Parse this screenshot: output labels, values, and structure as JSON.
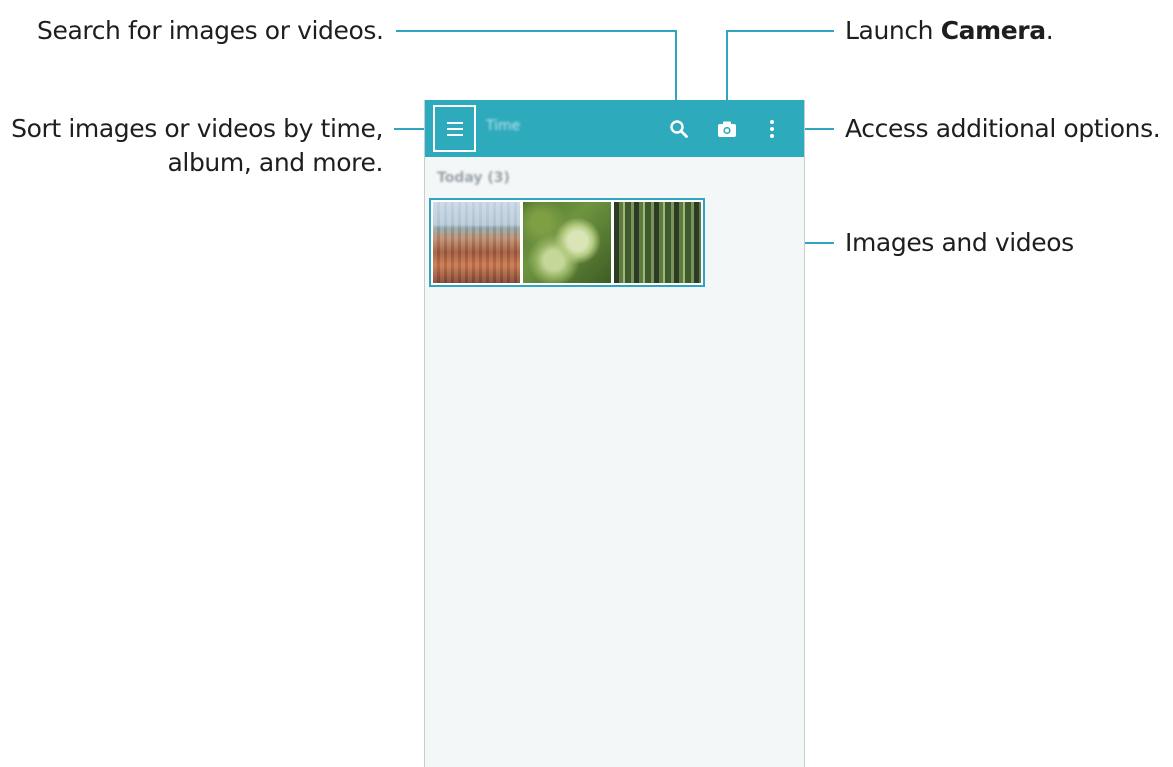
{
  "callouts": {
    "search": "Search for images or videos.",
    "camera_prefix": "Launch ",
    "camera_bold": "Camera",
    "camera_suffix": ".",
    "sort_line1": "Sort images or videos by time,",
    "sort_line2": "album, and more.",
    "options": "Access additional options.",
    "media": "Images and videos"
  },
  "app": {
    "title": "Time",
    "section_header": "Today (3)",
    "icons": [
      "menu-icon",
      "search-icon",
      "camera-icon",
      "more-options-icon"
    ],
    "thumbnails": [
      "city-photo",
      "leaf-photo",
      "forest-photo"
    ]
  },
  "colors": {
    "accent": "#2eaabd",
    "callout_line": "#2fa5bf",
    "background": "#f4f7f8"
  }
}
